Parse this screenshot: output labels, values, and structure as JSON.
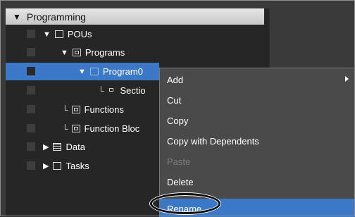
{
  "tree": {
    "header": "Programming",
    "rows": [
      {
        "label": "POUs"
      },
      {
        "label": "Programs"
      },
      {
        "label": "Program0"
      },
      {
        "label": "Sectio"
      },
      {
        "label": "Functions"
      },
      {
        "label": "Function Bloc"
      },
      {
        "label": "Data"
      },
      {
        "label": "Tasks"
      }
    ]
  },
  "context_menu": {
    "items": [
      {
        "label": "Add",
        "submenu": true,
        "enabled": true
      },
      {
        "label": "Cut",
        "enabled": true
      },
      {
        "label": "Copy",
        "enabled": true
      },
      {
        "label": "Copy with Dependents",
        "enabled": true
      },
      {
        "label": "Paste",
        "enabled": false
      },
      {
        "label": "Delete",
        "enabled": true
      },
      {
        "label": "Rename",
        "enabled": true,
        "highlighted": true
      }
    ]
  },
  "colors": {
    "selection": "#3b79c8",
    "menu_bg": "#4a4a4a",
    "panel_bg": "#262626"
  }
}
